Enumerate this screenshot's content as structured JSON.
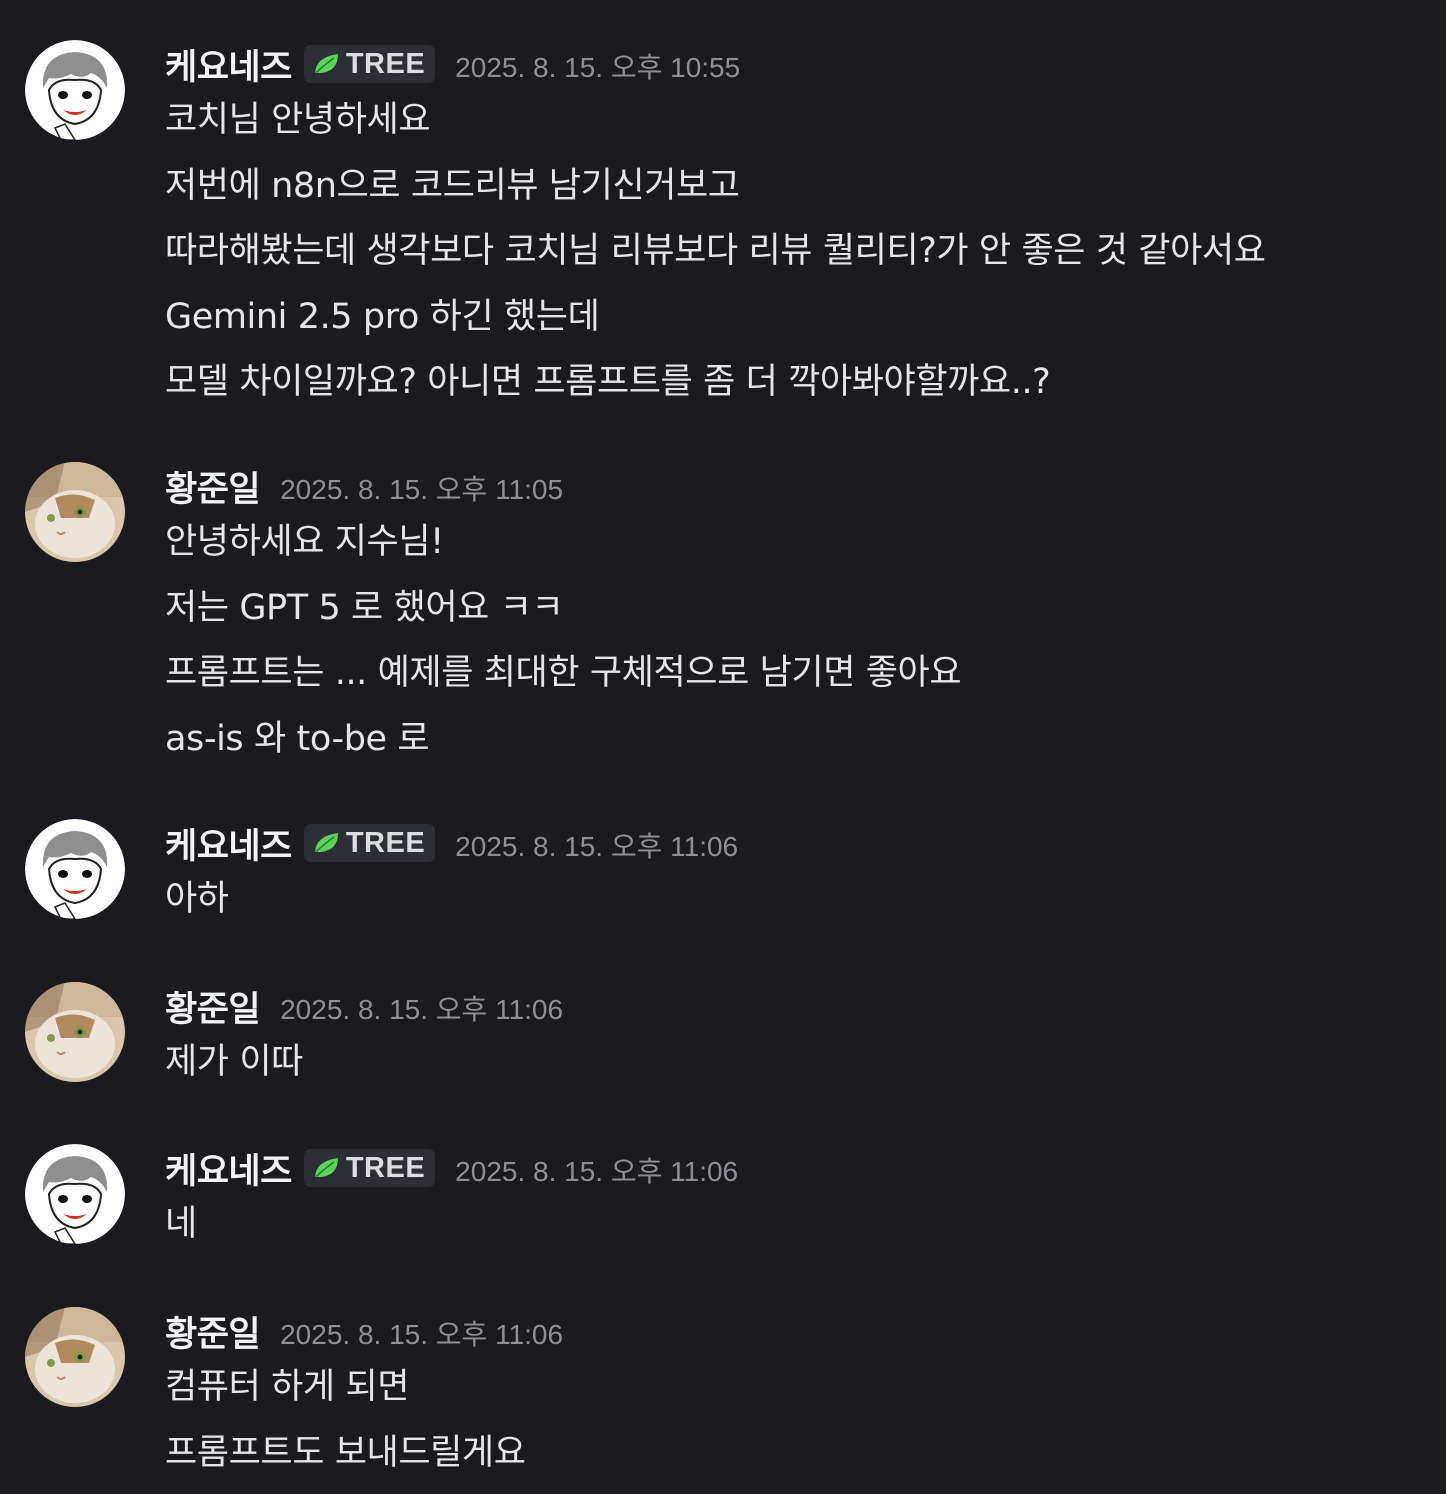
{
  "messages": [
    {
      "author": "케요네즈",
      "avatar": "cartoon-boy-avatar",
      "role": {
        "label": "TREE",
        "icon": "leaf-icon",
        "color": "#5bd35b"
      },
      "timestamp": "2025. 8. 15. 오후 10:55",
      "lines": [
        "코치님 안녕하세요",
        "저번에 n8n으로 코드리뷰 남기신거보고",
        "따라해봤는데 생각보다 코치님 리뷰보다 리뷰 퀄리티?가 안 좋은 것 같아서요",
        "Gemini 2.5 pro 하긴 했는데",
        "모델 차이일까요? 아니면 프롬프트를 좀 더 깍아봐야할까요..?"
      ]
    },
    {
      "author": "황준일",
      "avatar": "cat-avatar",
      "timestamp": "2025. 8. 15. 오후 11:05",
      "lines": [
        "안녕하세요 지수님!",
        "저는 GPT 5 로 했어요 ㅋㅋ",
        "프롬프트는 ... 예제를 최대한 구체적으로 남기면 좋아요",
        "as-is 와 to-be 로"
      ]
    },
    {
      "author": "케요네즈",
      "avatar": "cartoon-boy-avatar",
      "role": {
        "label": "TREE",
        "icon": "leaf-icon",
        "color": "#5bd35b"
      },
      "timestamp": "2025. 8. 15. 오후 11:06",
      "lines": [
        "아하"
      ]
    },
    {
      "author": "황준일",
      "avatar": "cat-avatar",
      "timestamp": "2025. 8. 15. 오후 11:06",
      "lines": [
        "제가 이따"
      ]
    },
    {
      "author": "케요네즈",
      "avatar": "cartoon-boy-avatar",
      "role": {
        "label": "TREE",
        "icon": "leaf-icon",
        "color": "#5bd35b"
      },
      "timestamp": "2025. 8. 15. 오후 11:06",
      "lines": [
        "네"
      ]
    },
    {
      "author": "황준일",
      "avatar": "cat-avatar",
      "timestamp": "2025. 8. 15. 오후 11:06",
      "lines": [
        "컴퓨터 하게 되면",
        "프롬프트도 보내드릴게요"
      ]
    }
  ]
}
